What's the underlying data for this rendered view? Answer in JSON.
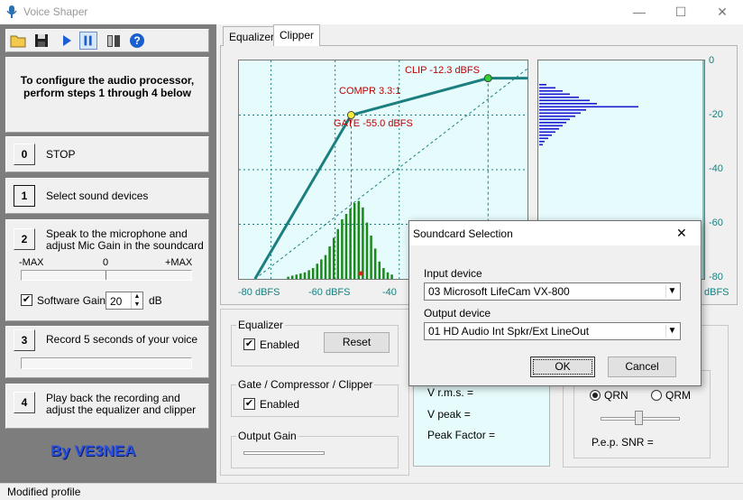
{
  "window": {
    "title": "Voice Shaper",
    "minimize": "—",
    "maximize": "☐",
    "close": "✕"
  },
  "toolbar": {
    "icons": [
      "open-folder-icon",
      "save-icon",
      "play-icon",
      "pause-icon",
      "book-icon",
      "help-icon"
    ]
  },
  "intro": "To configure the audio processor, perform steps 1 through 4 below",
  "steps": [
    {
      "num": "0",
      "text": "STOP"
    },
    {
      "num": "1",
      "text": "Select sound devices"
    },
    {
      "num": "2",
      "text": "Speak to the microphone and adjust Mic Gain in the soundcard"
    },
    {
      "num": "3",
      "text": "Record 5 seconds of your voice"
    },
    {
      "num": "4",
      "text": "Play back the recording and adjust the equalizer and clipper"
    }
  ],
  "level_meter": {
    "min_label": "-MAX",
    "mid_label": "0",
    "max_label": "+MAX"
  },
  "software_gain": {
    "label": "Software Gain",
    "value": "20",
    "unit": "dB",
    "checked": true
  },
  "credit": "By VE3NEA",
  "tabs": [
    {
      "label": "Equalizer"
    },
    {
      "label": "Clipper"
    }
  ],
  "chart_data": {
    "type": "line",
    "annotations": {
      "clip": "CLIP  -12.3 dBFS",
      "compr": "COMPR  3.3:1",
      "gate": "GATE  -55.0 dBFS"
    },
    "x_ticks": [
      "-80 dBFS",
      "-60 dBFS",
      "-40",
      "dBFS"
    ],
    "y_ticks": [
      "0",
      "-20",
      "-40",
      "-60",
      "-80"
    ],
    "transfer_curve": [
      {
        "x": -85,
        "y": -80
      },
      {
        "x": -55,
        "y": -20
      },
      {
        "x": -12.3,
        "y": -6.5
      },
      {
        "x": 0,
        "y": -6.5
      }
    ],
    "colors": {
      "curve": "#1b7f7f",
      "histogram": "#1a8a1a",
      "output_hist": "#1b1bd0",
      "plot_bg": "#e6fbfc"
    }
  },
  "equalizer_group": {
    "title": "Equalizer",
    "enabled_label": "Enabled",
    "reset_label": "Reset"
  },
  "gate_group": {
    "title": "Gate / Compressor / Clipper",
    "enabled_label": "Enabled"
  },
  "output_gain": {
    "title": "Output Gain"
  },
  "stats": {
    "vrms": "V r.m.s. =",
    "vpeak": "V peak =",
    "peak_factor": "Peak Factor ="
  },
  "noise": {
    "qrn": "QRN",
    "qrm": "QRM",
    "pep_snr": "P.e.p. SNR ="
  },
  "dialog": {
    "title": "Soundcard Selection",
    "input_label": "Input device",
    "input_value": "03  Microsoft LifeCam VX-800",
    "output_label": "Output device",
    "output_value": "01  HD Audio Int Spkr/Ext LineOut",
    "ok": "OK",
    "cancel": "Cancel",
    "close": "✕"
  },
  "status": "Modified profile"
}
